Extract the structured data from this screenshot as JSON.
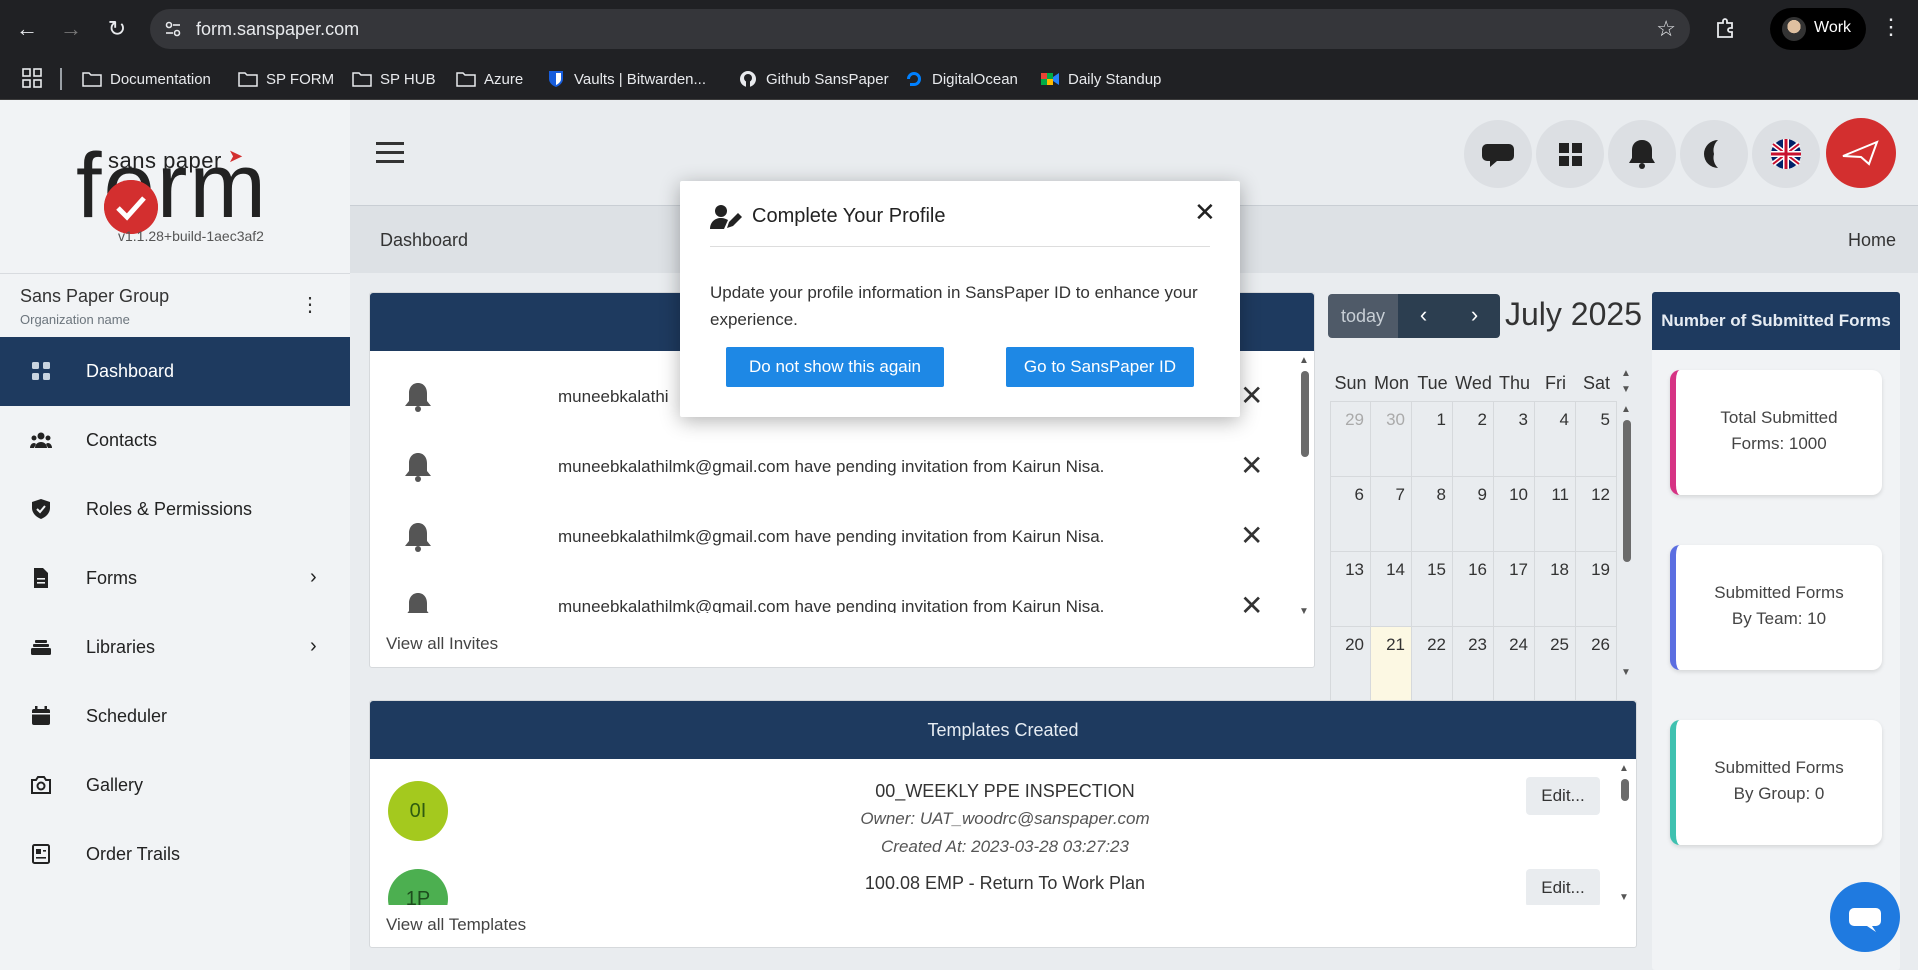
{
  "browser": {
    "url": "form.sanspaper.com",
    "profile_label": "Work",
    "bookmarks": [
      {
        "label": "Documentation",
        "icon": "folder-icon"
      },
      {
        "label": "SP FORM",
        "icon": "folder-icon"
      },
      {
        "label": "SP HUB",
        "icon": "folder-icon"
      },
      {
        "label": "Azure",
        "icon": "folder-icon"
      },
      {
        "label": "Vaults | Bitwarden...",
        "icon": "bitwarden-icon"
      },
      {
        "label": "Github SansPaper",
        "icon": "github-icon"
      },
      {
        "label": "DigitalOcean",
        "icon": "digitalocean-icon"
      },
      {
        "label": "Daily Standup",
        "icon": "meet-icon"
      }
    ]
  },
  "logo": {
    "small": "sans paper",
    "big": "form",
    "version": "v1.1.28+build-1aec3af2"
  },
  "org": {
    "name": "Sans Paper Group",
    "subtitle": "Organization name"
  },
  "menu": [
    {
      "label": "Dashboard",
      "icon": "grid-icon"
    },
    {
      "label": "Contacts",
      "icon": "users-icon"
    },
    {
      "label": "Roles & Permissions",
      "icon": "shield-icon"
    },
    {
      "label": "Forms",
      "icon": "document-icon"
    },
    {
      "label": "Libraries",
      "icon": "stack-icon"
    },
    {
      "label": "Scheduler",
      "icon": "calendar-icon"
    },
    {
      "label": "Gallery",
      "icon": "camera-icon"
    },
    {
      "label": "Order Trails",
      "icon": "receipt-icon"
    }
  ],
  "page": {
    "title": "Dashboard",
    "breadcrumb": "Home"
  },
  "invites": {
    "items": [
      "muneebkalathi",
      "muneebkalathilmk@gmail.com have pending invitation from Kairun Nisa.",
      "muneebkalathilmk@gmail.com have pending invitation from Kairun Nisa.",
      "muneebkalathilmk@gmail.com have pending invitation from Kairun Nisa."
    ],
    "view_all": "View all Invites"
  },
  "calendar": {
    "today_label": "today",
    "title": "July 2025",
    "dow": [
      "Sun",
      "Mon",
      "Tue",
      "Wed",
      "Thu",
      "Fri",
      "Sat"
    ],
    "weeks": [
      [
        "29",
        "30",
        "1",
        "2",
        "3",
        "4",
        "5"
      ],
      [
        "6",
        "7",
        "8",
        "9",
        "10",
        "11",
        "12"
      ],
      [
        "13",
        "14",
        "15",
        "16",
        "17",
        "18",
        "19"
      ],
      [
        "20",
        "21",
        "22",
        "23",
        "24",
        "25",
        "26"
      ]
    ],
    "today": "21"
  },
  "submitted": {
    "title": "Number of Submitted Forms",
    "cards": [
      {
        "line1": "Total Submitted",
        "line2": "Forms: 1000",
        "color": "#d63384"
      },
      {
        "line1": "Submitted Forms",
        "line2": "By Team: 10",
        "color": "#5b6ee1"
      },
      {
        "line1": "Submitted Forms",
        "line2": "By Group: 0",
        "color": "#3fc1b0"
      }
    ]
  },
  "templates": {
    "title": "Templates Created",
    "items": [
      {
        "avatar": "0I",
        "name": "00_WEEKLY PPE INSPECTION",
        "owner": "Owner: UAT_woodrc@sanspaper.com",
        "created": "Created At: 2023-03-28 03:27:23",
        "edit": "Edit...",
        "color": "#a4c91e"
      },
      {
        "avatar": "1P",
        "name": "100.08 EMP - Return To Work Plan",
        "owner": "",
        "created": "",
        "edit": "Edit...",
        "color": "#4caf50"
      }
    ],
    "view_all": "View all Templates"
  },
  "modal": {
    "title": "Complete Your Profile",
    "body": "Update your profile information in SansPaper ID to enhance your experience.",
    "btn_dismiss": "Do not show this again",
    "btn_go": "Go to SansPaper ID"
  }
}
